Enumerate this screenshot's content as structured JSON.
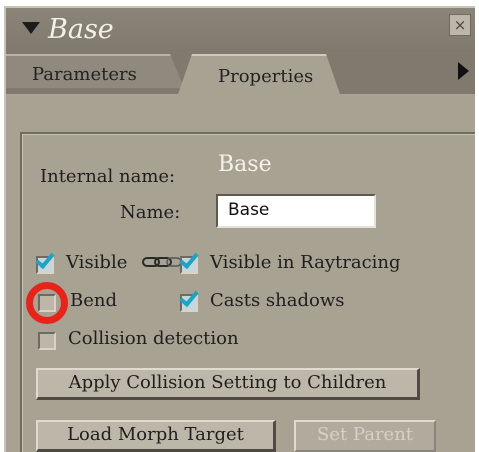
{
  "panel": {
    "title": "Base",
    "close_label": "×"
  },
  "tabs": {
    "parameters": "Parameters",
    "properties": "Properties",
    "active": "Properties"
  },
  "properties": {
    "internal_name_label": "Internal name:",
    "internal_name_value": "Base",
    "name_label": "Name:",
    "name_value": "Base",
    "checkboxes": {
      "visible": {
        "label": "Visible",
        "checked": true
      },
      "visible_in_raytracing": {
        "label": "Visible in Raytracing",
        "checked": true
      },
      "bend": {
        "label": "Bend",
        "checked": false
      },
      "casts_shadows": {
        "label": "Casts shadows",
        "checked": true
      },
      "collision_detection": {
        "label": "Collision detection",
        "checked": false
      }
    },
    "buttons": {
      "apply_collision": "Apply Collision Setting to Children",
      "load_morph_target": "Load Morph Target",
      "set_parent": "Set Parent"
    }
  },
  "colors": {
    "panel_bg": "#a8a293",
    "titlebar_bg": "#7f7a6d",
    "check_color": "#1aa5c8",
    "highlight_ring": "#e8231a"
  },
  "icons": {
    "title_toggle": "triangle-down-icon",
    "tab_scroll": "triangle-right-icon",
    "link": "chain-link-icon"
  }
}
